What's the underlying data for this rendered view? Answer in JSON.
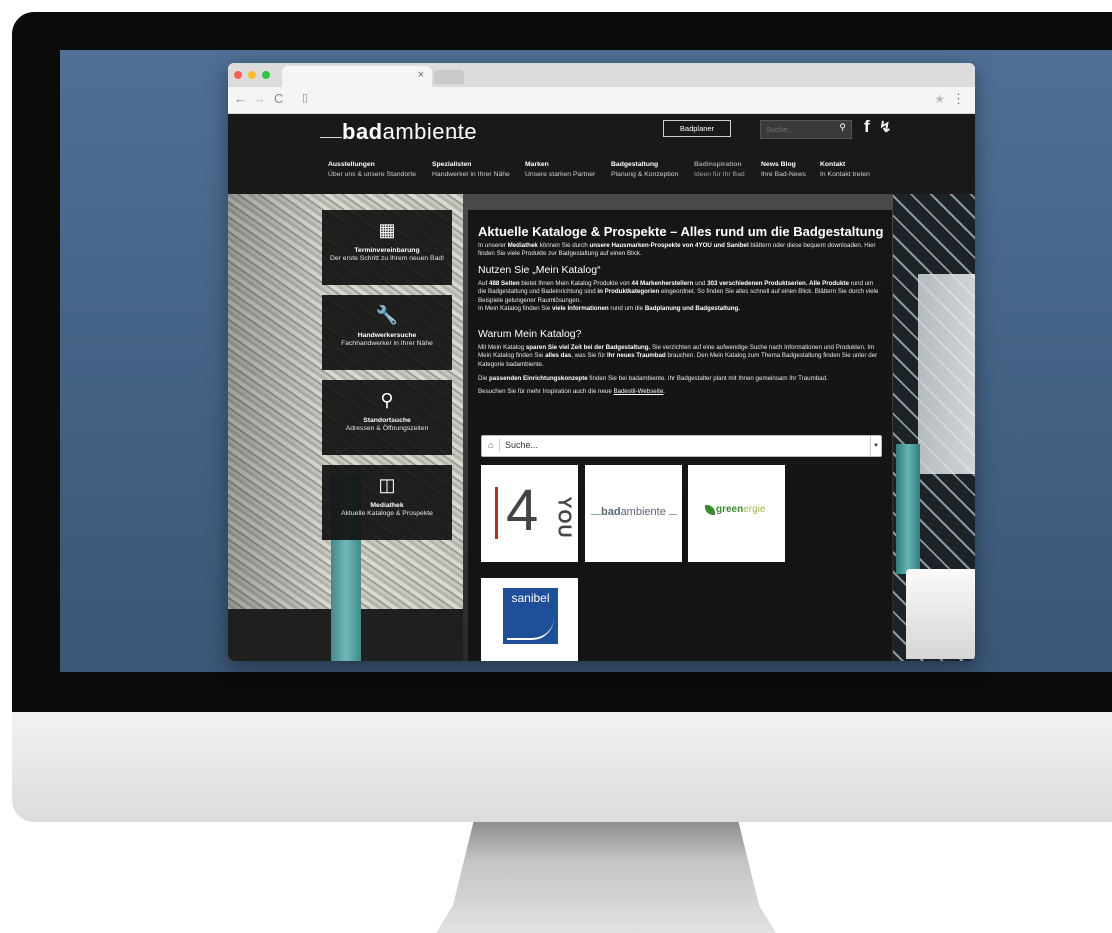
{
  "browser": {
    "tab_close": "×",
    "nav_back": "←",
    "nav_forward": "→",
    "nav_reload": "C",
    "star": "★",
    "menu": "⋮"
  },
  "site": {
    "logo_prefix": "bad",
    "logo_suffix": "ambiente",
    "badplaner": "Badplaner",
    "search_placeholder": "Suche...",
    "menu": [
      {
        "title": "Ausstellungen",
        "sub": "Über uns & unsere Standorte"
      },
      {
        "title": "Spezialisten",
        "sub": "Handwerker in Ihrer Nähe"
      },
      {
        "title": "Marken",
        "sub": "Unsere starken Partner"
      },
      {
        "title": "Badgestaltung",
        "sub": "Planung & Konzeption"
      },
      {
        "title": "Badinspiration",
        "sub": "Ideen für Ihr Bad"
      },
      {
        "title": "News Blog",
        "sub": "Ihre Bad-News"
      },
      {
        "title": "Kontakt",
        "sub": "In Kontakt treten"
      }
    ],
    "tiles": [
      {
        "title": "Terminvereinbarung",
        "sub": "Der erste Schritt zu Ihrem neuen Bad!",
        "icon": "calendar-icon"
      },
      {
        "title": "Handwerkersuche",
        "sub": "Fachhandwerker in Ihrer Nähe",
        "icon": "wrench-icon"
      },
      {
        "title": "Standortsuche",
        "sub": "Adressen & Öffnungszeiten",
        "icon": "location-pin-icon"
      },
      {
        "title": "Mediathek",
        "sub": "Aktuelle Kataloge & Prospekte",
        "icon": "catalog-icon"
      }
    ],
    "content": {
      "heading": "Aktuelle Kataloge & Prospekte – Alles rund um die Badgestaltung",
      "p1_a": "In unserer ",
      "p1_b": "Mediathek",
      "p1_c": " können Sie durch ",
      "p1_d": "unsere Hausmarken-Prospekte von 4YOU und Sanibel",
      "p1_e": " blättern oder diese bequem downloaden. Hier finden Sie viele Produkte zur Badgestaltung auf einen Blick.",
      "h2a": "Nutzen Sie „Mein Katalog“",
      "p2_a": "Auf ",
      "p2_b": "488 Seiten",
      "p2_c": " bietet Ihnen Mein Katalog Produkte von ",
      "p2_d": "44 Markenherstellern",
      "p2_e": " und ",
      "p2_f": "303 verschiedenen Produktserien. Alle Produkte",
      "p2_g": " rund um die Badgestaltung und Badeinrichtung sind ",
      "p2_h": "in Produktkategorien",
      "p2_i": " eingeordnet. So finden Sie alles schnell auf einen Blick. Blättern Sie durch viele Beispiele gelungener Raumlösungen.",
      "p2_j": "In Mein Katalog finden Sie ",
      "p2_k": "viele Informationen",
      "p2_l": " rund um die ",
      "p2_m": "Badplanung und Badgestaltung.",
      "h2b": "Warum Mein Katalog?",
      "p3_a": "Mit Mein Katalog ",
      "p3_b": "sparen Sie viel Zeit bei der Badgestaltung.",
      "p3_c": " Sie verzichten auf eine aufwendige Suche nach Informationen und Produkten. Im Mein Katalog finden Sie ",
      "p3_d": "alles das",
      "p3_e": ", was Sie für ",
      "p3_f": "Ihr neues Traumbad",
      "p3_g": " brauchen. Den Mein Katalog zum Thema Badgestaltung finden Sie unter der Kategorie badambiente.",
      "p4_a": "Die ",
      "p4_b": "passenden Einrichtungskonzepte",
      "p4_c": " finden Sie bei badambiente. Ihr Badgestalter plant mit Ihnen gemeinsam Ihr Traumbad.",
      "p5_a": "Besuchen Sie für mehr Inspiration auch die neue ",
      "p5_link": "Badestil-Webseite",
      "p5_end": "."
    },
    "catalog_search": "Suche...",
    "catalog_logos": [
      {
        "name": "4YOU",
        "mark": "4",
        "sub": "YOU"
      },
      {
        "name": "badambiente",
        "prefix": "bad",
        "suffix": "ambiente"
      },
      {
        "name": "greenergie",
        "a": "green",
        "b": "ergie"
      },
      {
        "name": "sanibel",
        "label": "sanibel"
      }
    ]
  },
  "colors": {
    "accent_4you": "#b0332e",
    "sanibel_blue": "#1f4f98",
    "greenergie_green": "#3c8a2e"
  }
}
